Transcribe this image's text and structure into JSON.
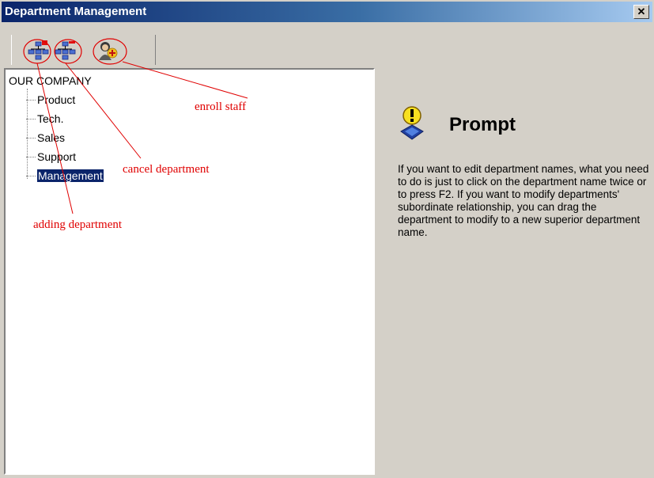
{
  "window": {
    "title": "Department Management",
    "close_label": "✕"
  },
  "toolbar": {
    "buttons": [
      {
        "name": "add-department",
        "icon": "org-chart-add-icon"
      },
      {
        "name": "cancel-department",
        "icon": "org-chart-remove-icon"
      },
      {
        "name": "enroll-staff",
        "icon": "person-add-icon"
      }
    ]
  },
  "tree": {
    "root": "OUR COMPANY",
    "items": [
      "Product",
      "Tech.",
      "Sales",
      "Support",
      "Management"
    ],
    "selected": "Management"
  },
  "prompt": {
    "icon": "lightbulb-info-icon",
    "title": "Prompt",
    "body": "If you want to edit department names, what you need to do is just to click on the department name twice or to press F2. If you want to modify departments' subordinate relationship, you can drag the department to modify to a new superior department name."
  },
  "annotations": {
    "enroll_staff": "enroll staff",
    "cancel_department": "cancel department",
    "adding_department": "adding department",
    "color": "#e00000"
  }
}
